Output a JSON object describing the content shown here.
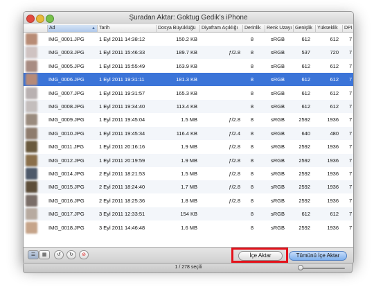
{
  "window": {
    "title": "Şuradan Aktar: Goktug Gedik’s iPhone"
  },
  "columns": {
    "name": "Ad",
    "date": "Tarih",
    "size": "Dosya Büyüklüğü",
    "aperture": "Diyafram Açıklığı",
    "depth": "Derinlik",
    "color": "Renk Uzayı",
    "width": "Genişlik",
    "height": "Yükseklik",
    "dpi": "DPI"
  },
  "rows": [
    {
      "name": "IMG_0001.JPG",
      "date": "1 Eyl 2011 14:38:12",
      "size": "150.2 KB",
      "aperture": "",
      "depth": "8",
      "color": "sRGB",
      "width": "612",
      "height": "612",
      "dpi": "7",
      "thumb": "#b88c76"
    },
    {
      "name": "IMG_0003.JPG",
      "date": "1 Eyl 2011 15:46:33",
      "size": "189.7 KB",
      "aperture": "ƒ/2.8",
      "depth": "8",
      "color": "sRGB",
      "width": "537",
      "height": "720",
      "dpi": "7",
      "thumb": "#cfc3c2"
    },
    {
      "name": "IMG_0005.JPG",
      "date": "1 Eyl 2011 15:55:49",
      "size": "163.9 KB",
      "aperture": "",
      "depth": "8",
      "color": "sRGB",
      "width": "612",
      "height": "612",
      "dpi": "7",
      "thumb": "#a88c82"
    },
    {
      "name": "IMG_0006.JPG",
      "date": "1 Eyl 2011 19:31:11",
      "size": "181.3 KB",
      "aperture": "",
      "depth": "8",
      "color": "sRGB",
      "width": "612",
      "height": "612",
      "dpi": "7",
      "thumb": "#b68a78"
    },
    {
      "name": "IMG_0007.JPG",
      "date": "1 Eyl 2011 19:31:57",
      "size": "165.3 KB",
      "aperture": "",
      "depth": "8",
      "color": "sRGB",
      "width": "612",
      "height": "612",
      "dpi": "7",
      "thumb": "#b9b1b1"
    },
    {
      "name": "IMG_0008.JPG",
      "date": "1 Eyl 2011 19:34:40",
      "size": "113.4 KB",
      "aperture": "",
      "depth": "8",
      "color": "sRGB",
      "width": "612",
      "height": "612",
      "dpi": "7",
      "thumb": "#c4bebd"
    },
    {
      "name": "IMG_0009.JPG",
      "date": "1 Eyl 2011 19:45:04",
      "size": "1.5 MB",
      "aperture": "ƒ/2.8",
      "depth": "8",
      "color": "sRGB",
      "width": "2592",
      "height": "1936",
      "dpi": "7",
      "thumb": "#9a8b7e"
    },
    {
      "name": "IMG_0010.JPG",
      "date": "1 Eyl 2011 19:45:34",
      "size": "116.4 KB",
      "aperture": "ƒ/2.4",
      "depth": "8",
      "color": "sRGB",
      "width": "640",
      "height": "480",
      "dpi": "7",
      "thumb": "#8e7c6d"
    },
    {
      "name": "IMG_0011.JPG",
      "date": "1 Eyl 2011 20:16:16",
      "size": "1.9 MB",
      "aperture": "ƒ/2.8",
      "depth": "8",
      "color": "sRGB",
      "width": "2592",
      "height": "1936",
      "dpi": "7",
      "thumb": "#6a5a3e"
    },
    {
      "name": "IMG_0012.JPG",
      "date": "1 Eyl 2011 20:19:59",
      "size": "1.9 MB",
      "aperture": "ƒ/2.8",
      "depth": "8",
      "color": "sRGB",
      "width": "2592",
      "height": "1936",
      "dpi": "7",
      "thumb": "#8a6f4a"
    },
    {
      "name": "IMG_0014.JPG",
      "date": "2 Eyl 2011 18:21:53",
      "size": "1.5 MB",
      "aperture": "ƒ/2.8",
      "depth": "8",
      "color": "sRGB",
      "width": "2592",
      "height": "1936",
      "dpi": "7",
      "thumb": "#4e5a6a"
    },
    {
      "name": "IMG_0015.JPG",
      "date": "2 Eyl 2011 18:24:40",
      "size": "1.7 MB",
      "aperture": "ƒ/2.8",
      "depth": "8",
      "color": "sRGB",
      "width": "2592",
      "height": "1936",
      "dpi": "7",
      "thumb": "#5d4e3a"
    },
    {
      "name": "IMG_0016.JPG",
      "date": "2 Eyl 2011 18:25:36",
      "size": "1.8 MB",
      "aperture": "ƒ/2.8",
      "depth": "8",
      "color": "sRGB",
      "width": "2592",
      "height": "1936",
      "dpi": "7",
      "thumb": "#7a6e68"
    },
    {
      "name": "IMG_0017.JPG",
      "date": "3 Eyl 2011 12:33:51",
      "size": "154 KB",
      "aperture": "",
      "depth": "8",
      "color": "sRGB",
      "width": "612",
      "height": "612",
      "dpi": "7",
      "thumb": "#b7aaa0"
    },
    {
      "name": "IMG_0018.JPG",
      "date": "3 Eyl 2011 14:46:48",
      "size": "1.6 MB",
      "aperture": "",
      "depth": "8",
      "color": "sRGB",
      "width": "2592",
      "height": "1936",
      "dpi": "7",
      "thumb": "#c6a489"
    }
  ],
  "selected_row_index": 3,
  "buttons": {
    "import": "İçe Aktar",
    "import_all": "Tümünü İçe Aktar"
  },
  "toolbar_icons": [
    "list-view-icon",
    "grid-view-icon",
    "rotate-left-icon",
    "rotate-right-icon",
    "delete-icon"
  ],
  "status": {
    "selection": "1 / 278 seçili"
  },
  "colors": {
    "selection": "#3b74d8",
    "highlight": "#e4121b"
  }
}
